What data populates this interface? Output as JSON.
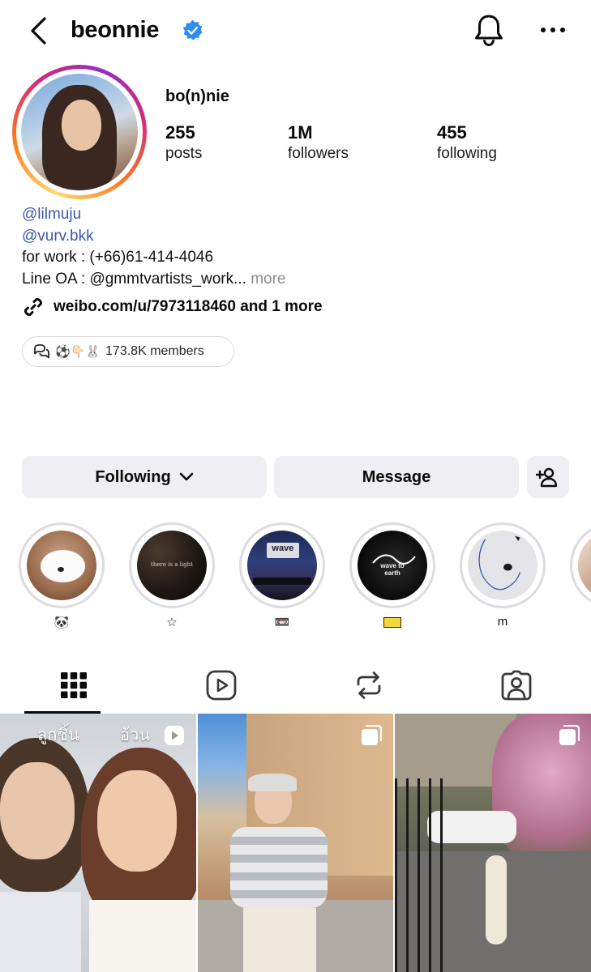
{
  "header": {
    "username": "beonnie"
  },
  "profile": {
    "display_name": "bo(n)nie",
    "stats": [
      {
        "number": "255",
        "label": "posts"
      },
      {
        "number": "1M",
        "label": "followers"
      },
      {
        "number": "455",
        "label": "following"
      }
    ],
    "bio": {
      "mentions": [
        "@lilmuju",
        "@vurv.bkk"
      ],
      "lines": [
        "for work : (+66)61-414-4046",
        "Line OA : @gmmtvartists_work..."
      ],
      "more_label": "more"
    },
    "link_text": "weibo.com/u/7973118460 and 1 more",
    "channel": {
      "emojis": "⚽👇🏻🐰",
      "members": "173.8K members"
    }
  },
  "actions": {
    "following_label": "Following",
    "message_label": "Message"
  },
  "highlights": [
    {
      "label": "🐼"
    },
    {
      "label": "☆"
    },
    {
      "label": "📼"
    },
    {
      "label": ""
    },
    {
      "label": "m"
    },
    {
      "label": ""
    }
  ],
  "highlight_image_text": {
    "h2": "there is a light",
    "h3": "wave",
    "h4": "wave to earth"
  },
  "posts": [
    {
      "overlay_left": "ลูกชิ้น",
      "overlay_right": "อ้วน"
    },
    {},
    {}
  ],
  "colors": {
    "mention": "#3b57a8",
    "verified": "#2f8cf0",
    "button_bg": "#efeff3",
    "muted": "#8e8e8e"
  }
}
